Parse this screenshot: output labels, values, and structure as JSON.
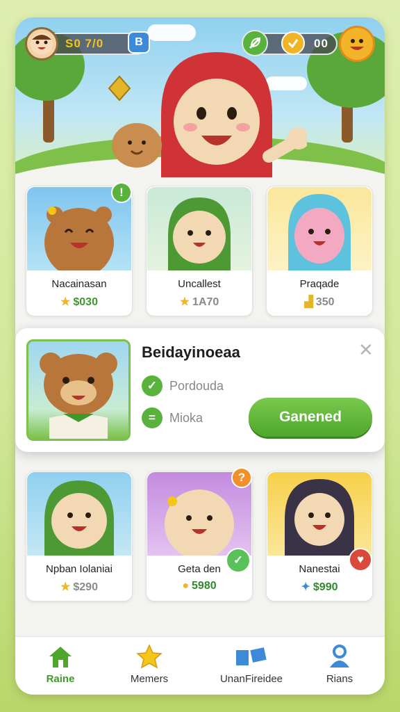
{
  "hud": {
    "score": "S0 7/0",
    "badge_icon": "b-badge-icon",
    "coins": "00"
  },
  "featured": [
    {
      "name": "Nacainasan",
      "price": "$030",
      "price_color": "#3d9a2a",
      "price_icon": "star",
      "corner_badge": "!"
    },
    {
      "name": "Uncallest",
      "price": "1A70",
      "price_color": "#8a8a8a",
      "price_icon": "star",
      "corner_badge": ""
    },
    {
      "name": "Praqade",
      "price": "350",
      "price_color": "#8a8a8a",
      "price_icon": "shoe",
      "corner_badge": ""
    }
  ],
  "modal": {
    "title": "Beidayinoeaa",
    "row1": "Pordouda",
    "row2": "Mioka",
    "cta": "Ganened",
    "close": "✕"
  },
  "more": [
    {
      "name": "Npban Iolaniai",
      "price": "$290",
      "price_color": "#3d9a2a",
      "price_icon": "star",
      "corner_badge": ""
    },
    {
      "name": "Geta den",
      "price": "5980",
      "price_color": "#2f8a2a",
      "price_icon": "coin",
      "corner_badge": "?"
    },
    {
      "name": "Nanestai",
      "price": "$990",
      "price_color": "#2f8a2a",
      "price_icon": "puzzle",
      "corner_badge": ""
    }
  ],
  "nav": [
    {
      "label": "Raine",
      "icon": "home-icon",
      "active": true
    },
    {
      "label": "Memers",
      "icon": "star-icon",
      "active": false
    },
    {
      "label": "UnanFireidee",
      "icon": "cards-icon",
      "active": false
    },
    {
      "label": "Rians",
      "icon": "person-icon",
      "active": false
    }
  ],
  "colors": {
    "accent": "#4fa62d",
    "background": "#d2e79a"
  }
}
